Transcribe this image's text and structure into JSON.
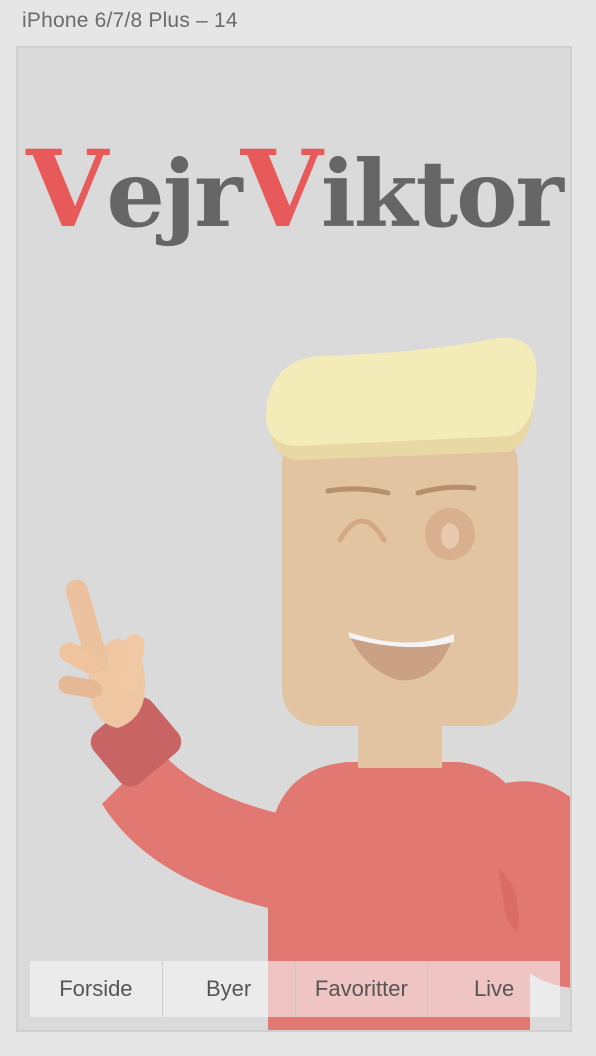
{
  "artboard_title": "iPhone 6/7/8 Plus – 14",
  "logo": {
    "part1_accent": "V",
    "part1_rest": "ejr",
    "part2_accent": "V",
    "part2_rest": "iktor"
  },
  "illustration": {
    "description_icon": "waving-person-illustration",
    "colors": {
      "hair": "#f3ecb8",
      "skin": "#e2c3a2",
      "shirt": "#e27872",
      "cuff": "#cc6464",
      "background": "#dadada"
    }
  },
  "bottom_nav": {
    "items": [
      {
        "label": "Forside"
      },
      {
        "label": "Byer"
      },
      {
        "label": "Favoritter"
      },
      {
        "label": "Live"
      }
    ]
  }
}
